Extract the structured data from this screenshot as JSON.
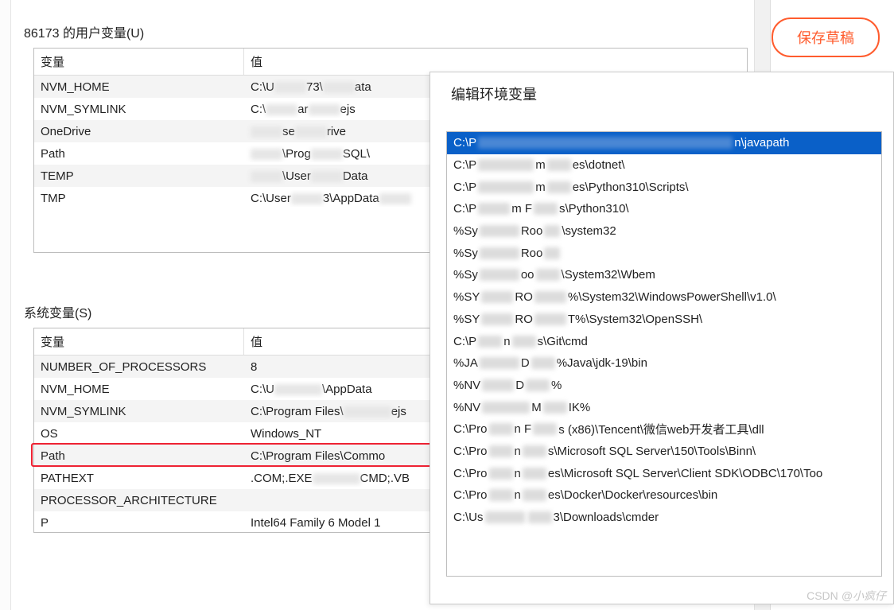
{
  "buttons": {
    "save_draft": "保存草稿"
  },
  "user_vars": {
    "label": "86173 的用户变量(U)",
    "col_var": "变量",
    "col_val": "值",
    "rows": [
      {
        "name": "NVM_HOME",
        "val_pre": "C:\\U",
        "val_post": "73\\",
        "val_tail": "ata"
      },
      {
        "name": "NVM_SYMLINK",
        "val_pre": "C:\\",
        "val_post": "ar",
        "val_tail": "ejs"
      },
      {
        "name": "OneDrive",
        "val_pre": "",
        "val_post": "se",
        "val_tail": "rive"
      },
      {
        "name": "Path",
        "val_pre": "",
        "val_post": "\\Prog",
        "val_tail": "SQL\\"
      },
      {
        "name": "TEMP",
        "val_pre": "",
        "val_post": "\\User",
        "val_tail": "Data"
      },
      {
        "name": "TMP",
        "val_pre": "C:\\User",
        "val_post": "3\\AppData",
        "val_tail": ""
      }
    ]
  },
  "sys_vars": {
    "label": "系统变量(S)",
    "col_var": "变量",
    "col_val": "值",
    "rows": [
      {
        "name": "NUMBER_OF_PROCESSORS",
        "val": "8"
      },
      {
        "name": "NVM_HOME",
        "val_pre": "C:\\U",
        "val_post": "\\AppData"
      },
      {
        "name": "NVM_SYMLINK",
        "val_pre": "C:\\Program Files\\",
        "val_post": "ejs"
      },
      {
        "name": "OS",
        "val": "Windows_NT"
      },
      {
        "name": "Path",
        "val": "C:\\Program Files\\Commo"
      },
      {
        "name": "PATHEXT",
        "val_pre": ".COM;.EXE",
        "val_post": "CMD;.VB"
      },
      {
        "name": "PROCESSOR_ARCHITECTURE",
        "val": ""
      },
      {
        "name": "P",
        "val": "Intel64 Family 6 Model 1"
      }
    ],
    "highlight_index": 4
  },
  "edit_dialog": {
    "title": "编辑环境变量",
    "items": [
      {
        "pre": "C:\\P",
        "post": "n\\javapath",
        "selected": true,
        "blurw": 320
      },
      {
        "pre": "C:\\P",
        "mid": "m",
        "post": "es\\dotnet\\",
        "blurw": 70,
        "blurw2": 30
      },
      {
        "pre": "C:\\P",
        "mid": "m",
        "post": "es\\Python310\\Scripts\\",
        "blurw": 70,
        "blurw2": 30
      },
      {
        "pre": "C:\\P",
        "mid": "m F",
        "post": "s\\Python310\\",
        "blurw": 40,
        "blurw2": 30
      },
      {
        "pre": "%Sy",
        "mid": "Roo",
        "post": "\\system32",
        "blurw": 50,
        "blurw2": 20
      },
      {
        "pre": "%Sy",
        "mid": "Roo",
        "post": "",
        "blurw": 50,
        "blurw2": 20
      },
      {
        "pre": "%Sy",
        "mid": "oo",
        "post": "\\System32\\Wbem",
        "blurw": 50,
        "blurw2": 30
      },
      {
        "pre": "%SY",
        "mid": "RO",
        "post": "%\\System32\\WindowsPowerShell\\v1.0\\",
        "blurw": 40,
        "blurw2": 40
      },
      {
        "pre": "%SY",
        "mid": "RO",
        "post": "T%\\System32\\OpenSSH\\",
        "blurw": 40,
        "blurw2": 40
      },
      {
        "pre": "C:\\P",
        "mid": "n",
        "post": "s\\Git\\cmd",
        "blurw": 30,
        "blurw2": 30
      },
      {
        "pre": "%JA",
        "mid": "D",
        "post": "%Java\\jdk-19\\bin",
        "blurw": 50,
        "blurw2": 30
      },
      {
        "pre": "%NV",
        "mid": "D",
        "post": "%",
        "blurw": 40,
        "blurw2": 30
      },
      {
        "pre": "%NV",
        "mid": "M",
        "post": "IK%",
        "blurw": 60,
        "blurw2": 30
      },
      {
        "pre": "C:\\Pro",
        "mid": "n F",
        "post": "s (x86)\\Tencent\\微信web开发者工具\\dll",
        "blurw": 30,
        "blurw2": 30
      },
      {
        "pre": "C:\\Pro",
        "mid": "n",
        "post": "s\\Microsoft SQL Server\\150\\Tools\\Binn\\",
        "blurw": 30,
        "blurw2": 30
      },
      {
        "pre": "C:\\Pro",
        "mid": "n",
        "post": "es\\Microsoft SQL Server\\Client SDK\\ODBC\\170\\Too",
        "blurw": 30,
        "blurw2": 30
      },
      {
        "pre": "C:\\Pro",
        "mid": "n",
        "post": "es\\Docker\\Docker\\resources\\bin",
        "blurw": 30,
        "blurw2": 30
      },
      {
        "pre": "C:\\Us",
        "mid": "",
        "post": "3\\Downloads\\cmder",
        "blurw": 50,
        "blurw2": 30
      }
    ]
  },
  "watermark": {
    "prefix": "CSDN",
    "author": "@小疯仔"
  }
}
